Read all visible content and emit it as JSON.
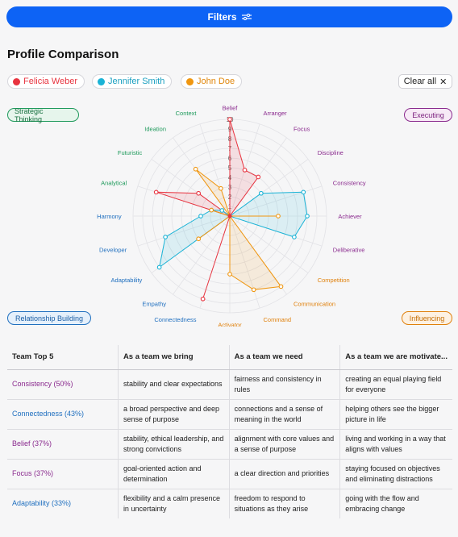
{
  "filters": {
    "label": "Filters",
    "icon": "sliders-icon"
  },
  "title": "Profile Comparison",
  "people": [
    {
      "name": "Felicia Weber",
      "color": "#e8333f"
    },
    {
      "name": "Jennifer Smith",
      "color": "#1ab3d6"
    },
    {
      "name": "John Doe",
      "color": "#f0960f"
    }
  ],
  "clear_all": {
    "label": "Clear all",
    "icon": "close-icon"
  },
  "domains": {
    "strategic": {
      "label": "Strategic Thinking",
      "color": "#1f9a5c"
    },
    "executing": {
      "label": "Executing",
      "color": "#8a2a8e"
    },
    "relationship": {
      "label": "Relationship Building",
      "color": "#1f6fbf"
    },
    "influencing": {
      "label": "Influencing",
      "color": "#e0800b"
    }
  },
  "chart_data": {
    "type": "radar",
    "scale": {
      "min": 0,
      "max": 10,
      "ticks": [
        "1",
        "2",
        "3",
        "4",
        "5",
        "6",
        "7",
        "8",
        "9",
        "10"
      ]
    },
    "axes": [
      {
        "name": "Belief",
        "domain": "executing"
      },
      {
        "name": "Arranger",
        "domain": "executing"
      },
      {
        "name": "Focus",
        "domain": "executing"
      },
      {
        "name": "Discipline",
        "domain": "executing"
      },
      {
        "name": "Consistency",
        "domain": "executing"
      },
      {
        "name": "Achiever",
        "domain": "executing"
      },
      {
        "name": "Deliberative",
        "domain": "executing"
      },
      {
        "name": "Competition",
        "domain": "influencing"
      },
      {
        "name": "Communication",
        "domain": "influencing"
      },
      {
        "name": "Command",
        "domain": "influencing"
      },
      {
        "name": "Activator",
        "domain": "influencing"
      },
      {
        "name": "Connectedness",
        "domain": "relationship"
      },
      {
        "name": "Empathy",
        "domain": "relationship"
      },
      {
        "name": "Adaptability",
        "domain": "relationship"
      },
      {
        "name": "Developer",
        "domain": "relationship"
      },
      {
        "name": "Harmony",
        "domain": "relationship"
      },
      {
        "name": "Analytical",
        "domain": "strategic"
      },
      {
        "name": "Futuristic",
        "domain": "strategic"
      },
      {
        "name": "Ideation",
        "domain": "strategic"
      },
      {
        "name": "Context",
        "domain": "strategic"
      }
    ],
    "series": [
      {
        "name": "Felicia Weber",
        "color": "#e8333f",
        "values": [
          10,
          5,
          5,
          0,
          0,
          0,
          0,
          0,
          0,
          0,
          0,
          9,
          0,
          0,
          0,
          0,
          8,
          4,
          0,
          0
        ]
      },
      {
        "name": "Jennifer Smith",
        "color": "#1ab3d6",
        "values": [
          0,
          0,
          0,
          4,
          8,
          8,
          7,
          0,
          0,
          0,
          0,
          0,
          0,
          9,
          7,
          3,
          2,
          1,
          0,
          0
        ]
      },
      {
        "name": "John Doe",
        "color": "#f0960f",
        "values": [
          0,
          0,
          0,
          0,
          0,
          5,
          0,
          0,
          9,
          8,
          6,
          0,
          0,
          4,
          0,
          0,
          2,
          0,
          6,
          3
        ]
      }
    ]
  },
  "table": {
    "headers": [
      "Team Top 5",
      "As a team we bring",
      "As a team we need",
      "As a team we are motivate..."
    ],
    "rows": [
      {
        "theme": "Consistency (50%)",
        "color": "#8a2a8e",
        "bring": "stability and clear expectations",
        "need": "fairness and consistency in rules",
        "motivated": "creating an equal playing field for everyone"
      },
      {
        "theme": "Connectedness (43%)",
        "color": "#1f6fbf",
        "bring": "a broad perspective and deep sense of purpose",
        "need": "connections and a sense of meaning in the world",
        "motivated": "helping others see the bigger picture in life"
      },
      {
        "theme": "Belief (37%)",
        "color": "#8a2a8e",
        "bring": "stability, ethical leadership, and strong convictions",
        "need": "alignment with core values and a sense of purpose",
        "motivated": "living and working in a way that aligns with values"
      },
      {
        "theme": "Focus (37%)",
        "color": "#8a2a8e",
        "bring": "goal-oriented action and determination",
        "need": "a clear direction and priorities",
        "motivated": "staying focused on objectives and eliminating distractions"
      },
      {
        "theme": "Adaptability (33%)",
        "color": "#1f6fbf",
        "bring": "flexibility and a calm presence in uncertainty",
        "need": "freedom to respond to situations as they arise",
        "motivated": "going with the flow and embracing change"
      }
    ]
  }
}
